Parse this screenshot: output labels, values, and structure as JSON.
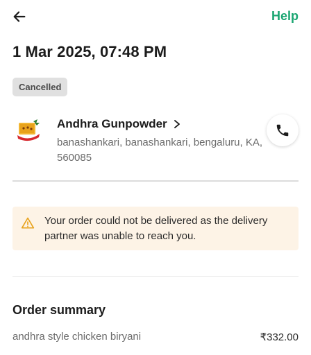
{
  "header": {
    "back_icon": "arrow-left-icon",
    "help_label": "Help",
    "accent_color": "#1ba672"
  },
  "order": {
    "datetime": "1 Mar 2025, 07:48 PM",
    "status": "Cancelled"
  },
  "restaurant": {
    "name": "Andhra Gunpowder",
    "address": "banashankari, banashankari, bengaluru, KA, 560085",
    "chevron_icon": "chevron-right-icon",
    "call_icon": "phone-icon"
  },
  "alert": {
    "icon": "warning-icon",
    "message": "Your order could not be delivered as the delivery partner was unable to reach you."
  },
  "summary": {
    "title": "Order summary",
    "items": [
      {
        "name": "andhra style chicken biryani",
        "price": "₹332.00"
      }
    ]
  }
}
